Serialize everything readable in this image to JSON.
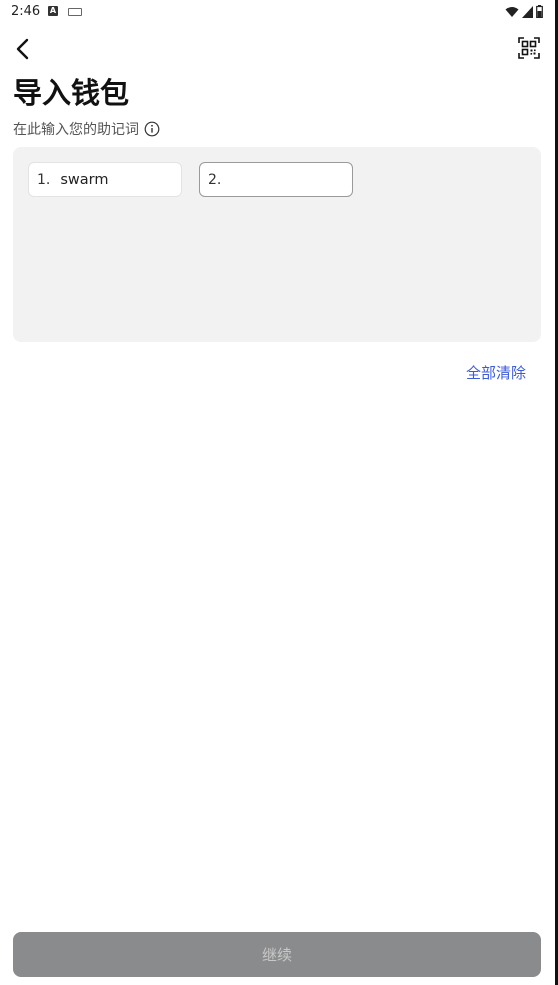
{
  "status_bar": {
    "time": "2:46",
    "notification_letter": "A",
    "icons": [
      "notification-a-icon",
      "keyboard-icon",
      "wifi-icon",
      "cellular-signal-icon",
      "battery-icon"
    ]
  },
  "header": {
    "back_icon": "chevron-left-icon",
    "scan_icon": "qr-scan-icon"
  },
  "page": {
    "title": "导入钱包",
    "subtitle": "在此输入您的助记词",
    "info_icon": "info-circle-icon"
  },
  "mnemonic": {
    "words": [
      {
        "index": "1.",
        "value": "swarm"
      },
      {
        "index": "2.",
        "value": ""
      }
    ]
  },
  "actions": {
    "clear_all": "全部清除",
    "continue": "继续"
  },
  "colors": {
    "link": "#3b5bdb",
    "area_bg": "#f2f2f2",
    "continue_disabled_bg": "#8a8b8c"
  }
}
